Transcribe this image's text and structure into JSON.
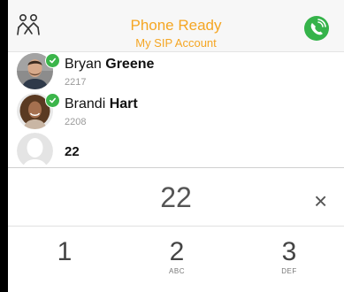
{
  "header": {
    "status_title": "Phone Ready",
    "account_name": "My SIP Account",
    "accent_color": "#f5a623",
    "call_color": "#35b34a"
  },
  "contacts": [
    {
      "first_name": "Bryan",
      "last_name": "Greene",
      "extension": "2217",
      "status": "available"
    },
    {
      "first_name": "Brandi",
      "last_name": "Hart",
      "extension": "2208",
      "status": "available"
    }
  ],
  "search_result": {
    "label": "22"
  },
  "dialer": {
    "number": "22",
    "clear_icon": "×",
    "keys": [
      {
        "digit": "1",
        "letters": ""
      },
      {
        "digit": "2",
        "letters": "ABC"
      },
      {
        "digit": "3",
        "letters": "DEF"
      }
    ]
  }
}
